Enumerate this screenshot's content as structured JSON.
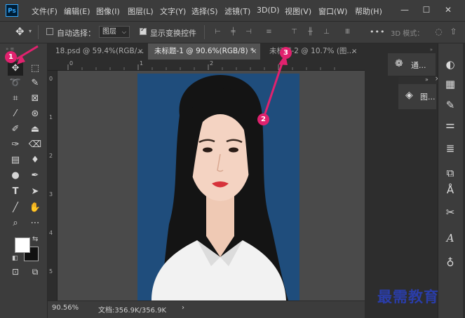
{
  "app": {
    "logo": "Ps"
  },
  "menu": [
    "文件(F)",
    "编辑(E)",
    "图像(I)",
    "图层(L)",
    "文字(Y)",
    "选择(S)",
    "滤镜(T)",
    "3D(D)",
    "视图(V)",
    "窗口(W)",
    "帮助(H)"
  ],
  "window_controls": {
    "minimize": "—",
    "maximize": "☐",
    "close": "✕"
  },
  "options": {
    "auto_select_label": "自动选择：",
    "auto_select_checked": false,
    "layer_select_value": "图层",
    "show_transform_label": "显示变换控件",
    "show_transform_checked": true,
    "more_label": "•••",
    "mode_label": "3D 模式："
  },
  "tabs": [
    {
      "label": "18.psd @ 59.4%(RGB/...",
      "close": "×",
      "active": false
    },
    {
      "label": "未标题-1 @ 90.6%(RGB/8) *",
      "close": "×",
      "active": true
    },
    {
      "label": "未标题-2 @ 10.7% (图...",
      "close": "×",
      "active": false
    }
  ],
  "ruler": {
    "h_marks": [
      "0",
      "1",
      "2",
      "3"
    ],
    "v_marks": [
      "0",
      "1",
      "2",
      "3",
      "4",
      "5"
    ]
  },
  "status": {
    "zoom": "90.56%",
    "doc": "文档:356.9K/356.9K",
    "arrow": "›"
  },
  "panels": {
    "channels_label": "通...",
    "layers_label": "图...",
    "collapse": "»",
    "close": "×"
  },
  "annotations": [
    "1",
    "2",
    "3"
  ],
  "watermark": "最需教育",
  "colors": {
    "accent": "#31a8ff",
    "badge": "#e0226e",
    "photo_bg": "#1f4d7c"
  }
}
